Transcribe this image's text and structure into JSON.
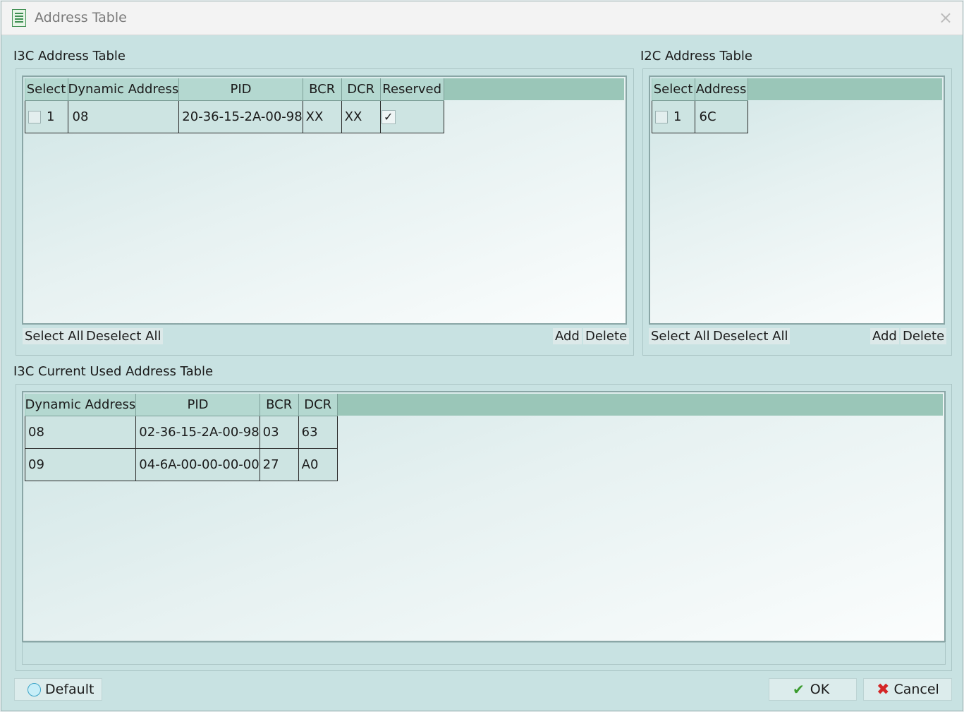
{
  "window": {
    "title": "Address Table"
  },
  "i3c": {
    "label": "I3C Address Table",
    "columns": [
      "Select",
      "Dynamic Address",
      "PID",
      "BCR",
      "DCR",
      "Reserved"
    ],
    "rows": [
      {
        "index": "1",
        "dynamic_address": "08",
        "pid": "20-36-15-2A-00-98",
        "bcr": "XX",
        "dcr": "XX",
        "reserved": true
      }
    ],
    "select_all": "Select All",
    "deselect_all": "Deselect All",
    "add": "Add",
    "delete": "Delete"
  },
  "i2c": {
    "label": "I2C Address Table",
    "columns": [
      "Select",
      "Address"
    ],
    "rows": [
      {
        "index": "1",
        "address": "6C"
      }
    ],
    "select_all": "Select All",
    "deselect_all": "Deselect All",
    "add": "Add",
    "delete": "Delete"
  },
  "current": {
    "label": "I3C Current Used Address Table",
    "columns": [
      "Dynamic Address",
      "PID",
      "BCR",
      "DCR"
    ],
    "rows": [
      {
        "dynamic_address": "08",
        "pid": "02-36-15-2A-00-98",
        "bcr": "03",
        "dcr": "63"
      },
      {
        "dynamic_address": "09",
        "pid": "04-6A-00-00-00-00",
        "bcr": "27",
        "dcr": "A0"
      }
    ]
  },
  "footer": {
    "default": "Default",
    "ok": "OK",
    "cancel": "Cancel"
  },
  "icons": {
    "check": "✓",
    "ok": "✔",
    "cancel": "✖",
    "close": "×"
  }
}
